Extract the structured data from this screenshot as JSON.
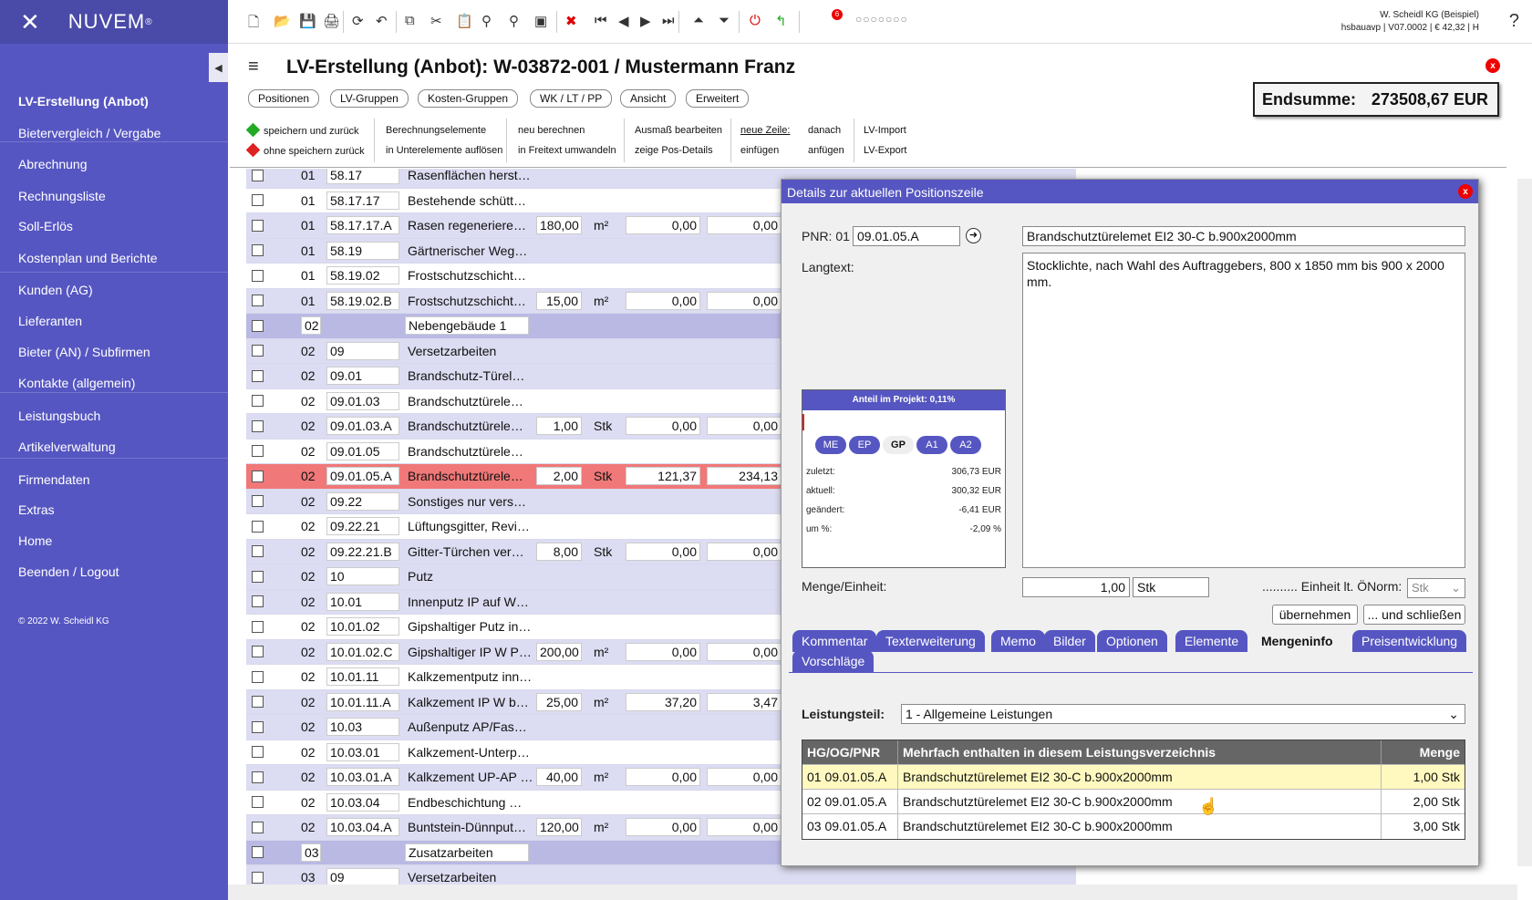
{
  "app": {
    "logo": "NUVEM",
    "logo_sup": "®",
    "logo_icon": "✕"
  },
  "sidebar": {
    "items": [
      "LV-Erstellung (Anbot)",
      "Bietervergleich / Vergabe",
      "Abrechnung",
      "Rechnungsliste",
      "Soll-Erlös",
      "Kostenplan und Berichte",
      "Kunden (AG)",
      "Lieferanten",
      "Bieter (AN) / Subfirmen",
      "Kontakte (allgemein)",
      "Leistungsbuch",
      "Artikelverwaltung",
      "Firmendaten",
      "Extras",
      "Home",
      "Beenden / Logout"
    ],
    "copyright": "© 2022 W. Scheidl KG",
    "toggle_icon": "◀"
  },
  "topbar": {
    "company_line1": "W. Scheidl KG (Beispiel)",
    "company_line2": "hsbauavp | V07.0002 | € 42,32 | H",
    "help": "?",
    "badge": "6",
    "dots": "○○○○○○○",
    "icons": [
      "new-doc",
      "open",
      "save",
      "print",
      "refresh",
      "undo",
      "copy",
      "cut",
      "paste",
      "find-replace",
      "search",
      "window",
      "delete",
      "first",
      "prev",
      "next",
      "last",
      "up",
      "down",
      "power",
      "green-arrow"
    ]
  },
  "page": {
    "hamburger": "≡",
    "title": "LV-Erstellung (Anbot): W-03872-001 / Mustermann Franz",
    "close": "x"
  },
  "endsumme": {
    "label": "Endsumme:",
    "value": "273508,67 EUR"
  },
  "tabs": [
    "Positionen",
    "LV-Gruppen",
    "Kosten-Gruppen",
    "WK / LT / PP",
    "Ansicht",
    "Erweitert"
  ],
  "actions": {
    "save_back": "speichern und zurück",
    "nosave_back": "ohne speichern zurück",
    "calc_elements": "Berechnungselemente",
    "resolve": "in Unterelemente auflösen",
    "recalc": "neu berechnen",
    "to_freetext": "in Freitext umwandeln",
    "ausmass": "Ausmaß bearbeiten",
    "pos_details": "zeige Pos-Details",
    "new_line": "neue Zeile:",
    "insert": "einfügen",
    "after": "danach",
    "append": "anfügen",
    "lv_import": "LV-Import",
    "lv_export": "LV-Export"
  },
  "grid_rows": [
    {
      "style": "light",
      "hg": "01",
      "pnr": "58.17",
      "text": "Rasenflächen herst…",
      "qty": "",
      "unit": "",
      "ep": "",
      "gp": ""
    },
    {
      "style": "white",
      "hg": "01",
      "pnr": "58.17.17",
      "text": "Bestehende schütt…",
      "qty": "",
      "unit": "",
      "ep": "",
      "gp": ""
    },
    {
      "style": "light",
      "hg": "01",
      "pnr": "58.17.17.A",
      "text": "Rasen regeneriere…",
      "qty": "180,00",
      "unit": "m²",
      "ep": "0,00",
      "gp": "0,00"
    },
    {
      "style": "light",
      "hg": "01",
      "pnr": "58.19",
      "text": "Gärtnerischer Weg…",
      "qty": "",
      "unit": "",
      "ep": "",
      "gp": ""
    },
    {
      "style": "white",
      "hg": "01",
      "pnr": "58.19.02",
      "text": "Frostschutzschicht…",
      "qty": "",
      "unit": "",
      "ep": "",
      "gp": ""
    },
    {
      "style": "light",
      "hg": "01",
      "pnr": "58.19.02.B",
      "text": "Frostschutzschicht…",
      "qty": "15,00",
      "unit": "m²",
      "ep": "0,00",
      "gp": "0,00"
    },
    {
      "style": "purple",
      "hg": "02",
      "pnr": "",
      "text": "Nebengebäude 1",
      "qty": "",
      "unit": "",
      "ep": "",
      "gp": ""
    },
    {
      "style": "light",
      "hg": "02",
      "pnr": "09",
      "text": "Versetzarbeiten",
      "qty": "",
      "unit": "",
      "ep": "",
      "gp": ""
    },
    {
      "style": "light",
      "hg": "02",
      "pnr": "09.01",
      "text": "Brandschutz-Türel…",
      "qty": "",
      "unit": "",
      "ep": "",
      "gp": ""
    },
    {
      "style": "white",
      "hg": "02",
      "pnr": "09.01.03",
      "text": "Brandschutztürele…",
      "qty": "",
      "unit": "",
      "ep": "",
      "gp": ""
    },
    {
      "style": "light",
      "hg": "02",
      "pnr": "09.01.03.A",
      "text": "Brandschutztürele…",
      "qty": "1,00",
      "unit": "Stk",
      "ep": "0,00",
      "gp": "0,00"
    },
    {
      "style": "white",
      "hg": "02",
      "pnr": "09.01.05",
      "text": "Brandschutztürele…",
      "qty": "",
      "unit": "",
      "ep": "",
      "gp": ""
    },
    {
      "style": "selected",
      "hg": "02",
      "pnr": "09.01.05.A",
      "text": "Brandschutztürele…",
      "qty": "2,00",
      "unit": "Stk",
      "ep": "121,37",
      "gp": "234,13"
    },
    {
      "style": "light",
      "hg": "02",
      "pnr": "09.22",
      "text": "Sonstiges nur vers…",
      "qty": "",
      "unit": "",
      "ep": "",
      "gp": ""
    },
    {
      "style": "white",
      "hg": "02",
      "pnr": "09.22.21",
      "text": "Lüftungsgitter, Revi…",
      "qty": "",
      "unit": "",
      "ep": "",
      "gp": ""
    },
    {
      "style": "light",
      "hg": "02",
      "pnr": "09.22.21.B",
      "text": "Gitter-Türchen ver…",
      "qty": "8,00",
      "unit": "Stk",
      "ep": "0,00",
      "gp": "0,00"
    },
    {
      "style": "light",
      "hg": "02",
      "pnr": "10",
      "text": "Putz",
      "qty": "",
      "unit": "",
      "ep": "",
      "gp": ""
    },
    {
      "style": "light",
      "hg": "02",
      "pnr": "10.01",
      "text": "Innenputz IP auf W…",
      "qty": "",
      "unit": "",
      "ep": "",
      "gp": ""
    },
    {
      "style": "white",
      "hg": "02",
      "pnr": "10.01.02",
      "text": "Gipshaltiger Putz in…",
      "qty": "",
      "unit": "",
      "ep": "",
      "gp": ""
    },
    {
      "style": "light",
      "hg": "02",
      "pnr": "10.01.02.C",
      "text": "Gipshaltiger IP W P…",
      "qty": "200,00",
      "unit": "m²",
      "ep": "0,00",
      "gp": "0,00"
    },
    {
      "style": "white",
      "hg": "02",
      "pnr": "10.01.11",
      "text": "Kalkzementputz inn…",
      "qty": "",
      "unit": "",
      "ep": "",
      "gp": ""
    },
    {
      "style": "light",
      "hg": "02",
      "pnr": "10.01.11.A",
      "text": "Kalkzement IP W b…",
      "qty": "25,00",
      "unit": "m²",
      "ep": "37,20",
      "gp": "3,47"
    },
    {
      "style": "light",
      "hg": "02",
      "pnr": "10.03",
      "text": "Außenputz AP/Fas…",
      "qty": "",
      "unit": "",
      "ep": "",
      "gp": ""
    },
    {
      "style": "white",
      "hg": "02",
      "pnr": "10.03.01",
      "text": "Kalkzement-Unterp…",
      "qty": "",
      "unit": "",
      "ep": "",
      "gp": ""
    },
    {
      "style": "light",
      "hg": "02",
      "pnr": "10.03.01.A",
      "text": "Kalkzement UP-AP …",
      "qty": "40,00",
      "unit": "m²",
      "ep": "0,00",
      "gp": "0,00"
    },
    {
      "style": "white",
      "hg": "02",
      "pnr": "10.03.04",
      "text": "Endbeschichtung …",
      "qty": "",
      "unit": "",
      "ep": "",
      "gp": ""
    },
    {
      "style": "light",
      "hg": "02",
      "pnr": "10.03.04.A",
      "text": "Buntstein-Dünnput…",
      "qty": "120,00",
      "unit": "m²",
      "ep": "0,00",
      "gp": "0,00"
    },
    {
      "style": "purple",
      "hg": "03",
      "pnr": "",
      "text": "Zusatzarbeiten",
      "qty": "",
      "unit": "",
      "ep": "",
      "gp": ""
    },
    {
      "style": "light",
      "hg": "03",
      "pnr": "09",
      "text": "Versetzarbeiten",
      "qty": "",
      "unit": "",
      "ep": "",
      "gp": ""
    }
  ],
  "dialog": {
    "title": "Details zur aktuellen Positionszeile",
    "close": "x",
    "pnr_label": "PNR: 01",
    "pnr_value": "09.01.05.A",
    "short_text": "Brandschutztürelemet EI2 30-C b.900x2000mm",
    "langtext_label": "Langtext:",
    "langtext": "Stocklichte, nach Wahl des Auftraggebers, 800 x 1850 mm bis 900 x 2000 mm.",
    "anteil": "Anteil im Projekt: 0,11%",
    "anteil_fraction": 0.0011,
    "pills": [
      "ME",
      "EP",
      "GP",
      "A1",
      "A2"
    ],
    "active_pill": "GP",
    "stats": [
      {
        "label": "zuletzt:",
        "value": "306,73 EUR"
      },
      {
        "label": "aktuell:",
        "value": "300,32 EUR"
      },
      {
        "label": "geändert:",
        "value": "-6,41 EUR"
      },
      {
        "label": "um %:",
        "value": "-2,09 %"
      }
    ],
    "menge_label": "Menge/Einheit:",
    "menge_value": "1,00",
    "einheit_value": "Stk",
    "oenorm_label": ".......... Einheit lt. ÖNorm:",
    "oenorm_value": "Stk",
    "btn_apply": "übernehmen",
    "btn_apply_close": "... und schließen",
    "tabs": [
      "Kommentar",
      "Texterweiterung",
      "Memo",
      "Bilder",
      "Optionen",
      "Elemente",
      "Mengeninfo",
      "Preisentwicklung",
      "Vorschläge"
    ],
    "active_tab": "Mengeninfo",
    "leistungsteil_label": "Leistungsteil:",
    "leistungsteil_value": "1 - Allgemeine Leistungen",
    "table_headers": [
      "HG/OG/PNR",
      "Mehrfach enthalten in diesem Leistungsverzeichnis",
      "Menge"
    ],
    "table_rows": [
      {
        "pnr": "01 09.01.05.A",
        "text": "Brandschutztürelemet EI2 30-C b.900x2000mm",
        "menge": "1,00 Stk"
      },
      {
        "pnr": "02 09.01.05.A",
        "text": "Brandschutztürelemet EI2 30-C b.900x2000mm",
        "menge": "2,00 Stk"
      },
      {
        "pnr": "03 09.01.05.A",
        "text": "Brandschutztürelemet EI2 30-C b.900x2000mm",
        "menge": "3,00 Stk"
      }
    ]
  },
  "colors": {
    "sidebar": "#5656c2",
    "accent": "#5656c2",
    "selected_row": "#f07878",
    "highlight_row": "#fff9c0"
  }
}
